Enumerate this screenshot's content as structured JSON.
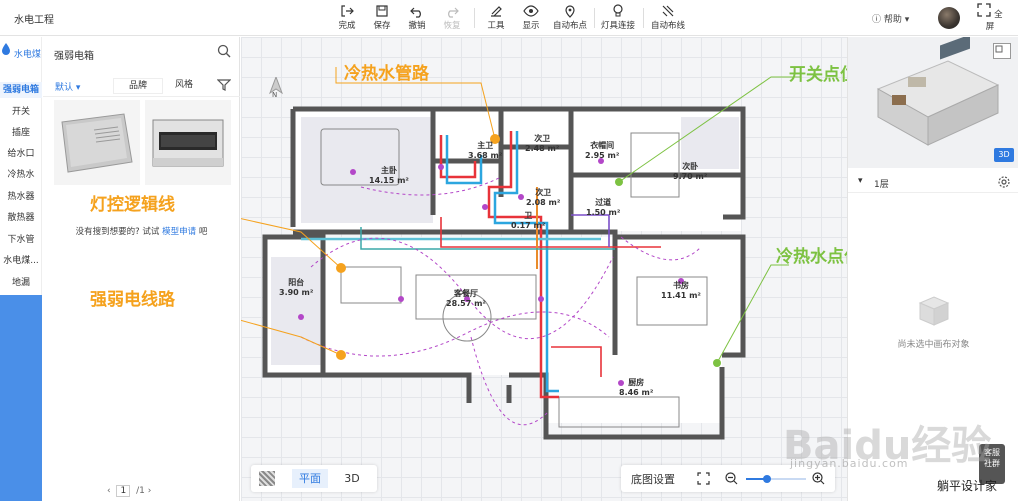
{
  "app": {
    "title": "水电工程"
  },
  "toolbar": {
    "complete": "完成",
    "save": "保存",
    "undo": "撤销",
    "redo": "恢复",
    "tools": "工具",
    "display": "显示",
    "auto_points": "自动布点",
    "lamp_connect": "灯具连接",
    "auto_wiring": "自动布线",
    "help": "帮助",
    "fullscreen": "全屏"
  },
  "category_nav": {
    "header": "水电煤",
    "items": [
      "强弱电箱",
      "开关",
      "插座",
      "给水口",
      "冷热水",
      "热水器",
      "散热器",
      "下水管",
      "水电煤...",
      "地漏"
    ],
    "active_index": 0
  },
  "product_panel": {
    "search_value": "强弱电箱",
    "filters": {
      "default": "默认",
      "brand": "品牌",
      "style": "风格"
    },
    "empty_msg_prefix": "没有搜到想要的? 试试",
    "empty_msg_link": "模型申请",
    "empty_msg_suffix": "吧",
    "pager": {
      "current": "1",
      "total": "/1"
    }
  },
  "floorplan": {
    "rooms": [
      {
        "name": "主卧",
        "area": "14.15 m²"
      },
      {
        "name": "主卫",
        "area": "3.68 m²"
      },
      {
        "name": "次卫",
        "area": "2.48 m²"
      },
      {
        "name": "衣帽间",
        "area": "2.95 m²"
      },
      {
        "name": "次卧",
        "area": "9.70 m²"
      },
      {
        "name": "次卫",
        "area": "2.08 m²"
      },
      {
        "name": "过道",
        "area": "1.50 m²"
      },
      {
        "name": "卫",
        "area": "0.17 m²"
      },
      {
        "name": "阳台",
        "area": "3.90 m²"
      },
      {
        "name": "客餐厅",
        "area": "28.57 m²"
      },
      {
        "name": "书房",
        "area": "11.41 m²"
      },
      {
        "name": "厨房",
        "area": "8.46 m²"
      }
    ]
  },
  "annotations": {
    "water_pipe": "冷热水管路",
    "switch_point": "开关点位",
    "light_logic": "灯控逻辑线",
    "power_line": "强弱电线路",
    "water_point": "冷热水点位"
  },
  "view_controls": {
    "plan": "平面",
    "three_d": "3D",
    "base_setting": "底图设置",
    "zoom_fraction": 0.35
  },
  "right_panel": {
    "preview_3d_btn": "3D",
    "floor": "1层",
    "empty_msg": "尚未选中画布对象",
    "service": "客服",
    "service2": "社群"
  },
  "watermark": {
    "brand": "Baidu经验",
    "url": "jingyan.baidu.com",
    "author": "躺平设计家"
  },
  "colors": {
    "accent": "#2f7ae0",
    "annotation_orange": "#f5a21e",
    "annotation_green": "#7dc242",
    "hot_water": "#e8333a",
    "cold_water": "#2ca6df"
  }
}
